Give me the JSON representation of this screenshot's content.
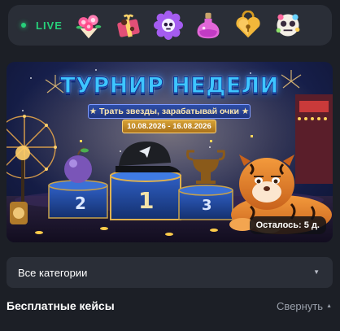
{
  "live": {
    "label": "LIVE",
    "items": [
      {
        "icon": "flower-bouquet-icon"
      },
      {
        "icon": "gift-box-icon"
      },
      {
        "icon": "skull-flower-icon"
      },
      {
        "icon": "potion-bottle-icon"
      },
      {
        "icon": "golden-heart-lock-icon"
      },
      {
        "icon": "candy-skull-icon"
      }
    ],
    "accent": "#27d07a"
  },
  "banner": {
    "title": "ТУРНИР НЕДЕЛИ",
    "subtitle": "★ Трать звезды, зарабатывай очки ★",
    "dates": "10.08.2026 - 16.08.2026",
    "podium": [
      "2",
      "1",
      "3"
    ],
    "remaining": "Осталось: 5 д."
  },
  "filters": {
    "category_value": "Все категории"
  },
  "section": {
    "title": "Бесплатные кейсы",
    "collapse_label": "Свернуть"
  }
}
